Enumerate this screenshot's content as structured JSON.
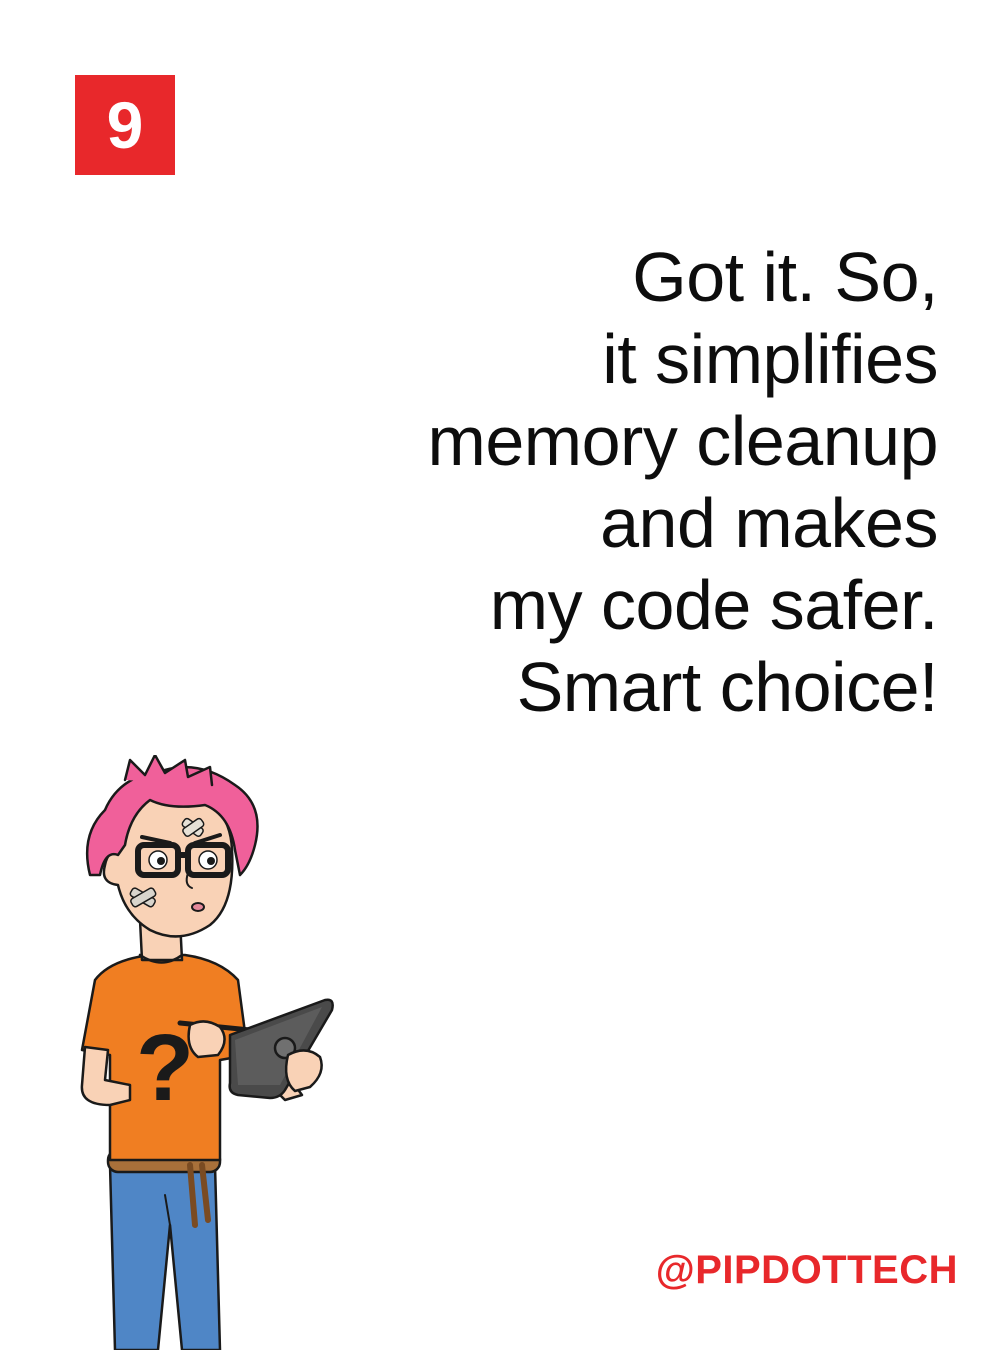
{
  "slide": {
    "page_number": "9",
    "brand_color": "#e8282b",
    "text_color": "#0d0d0d",
    "background_color": "#ffffff"
  },
  "dialog": {
    "lines": [
      "Got it. So,",
      "it simplifies",
      "memory cleanup",
      "and makes",
      "my code safer.",
      "Smart choice!"
    ]
  },
  "footer": {
    "handle": "@PIPDOTTECH"
  },
  "illustration": {
    "subject": "character-with-tablet",
    "hair_color": "#f0609a",
    "shirt_color": "#f07e22",
    "jeans_color": "#4f86c6",
    "shirt_symbol": "?"
  }
}
